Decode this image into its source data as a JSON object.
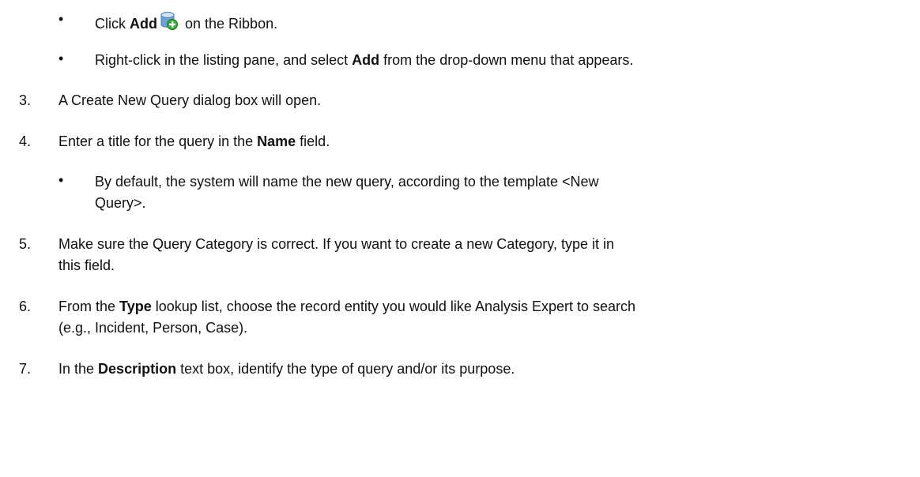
{
  "sub_bullets_step2": [
    {
      "pre": "Click ",
      "bold": "Add",
      "post": " on the Ribbon.",
      "icon": "database-add-icon"
    },
    {
      "pre": "Right-click in the listing pane, and select ",
      "bold": "Add",
      "post": " from the drop-down menu that appears."
    }
  ],
  "steps": [
    {
      "num": "3.",
      "text": "A Create New Query dialog box will open."
    },
    {
      "num": "4.",
      "pre": "Enter a title for the query in the ",
      "bold": "Name",
      "post": " field.",
      "sub": [
        {
          "line1": "By default, the system will name the new query, according to the template <New",
          "line2": "Query>."
        }
      ]
    },
    {
      "num": "5.",
      "line1": "Make sure the Query Category is correct. If you want to create a new Category, type it in",
      "line2": "this field."
    },
    {
      "num": "6.",
      "pre": "From the ",
      "bold": "Type",
      "post": " lookup list, choose the record entity you would like Analysis Expert to search",
      "line2": "(e.g., Incident, Person, Case)."
    },
    {
      "num": "7.",
      "pre": "In the ",
      "bold": "Description",
      "post": " text box, identify the type of query and/or its purpose."
    }
  ]
}
